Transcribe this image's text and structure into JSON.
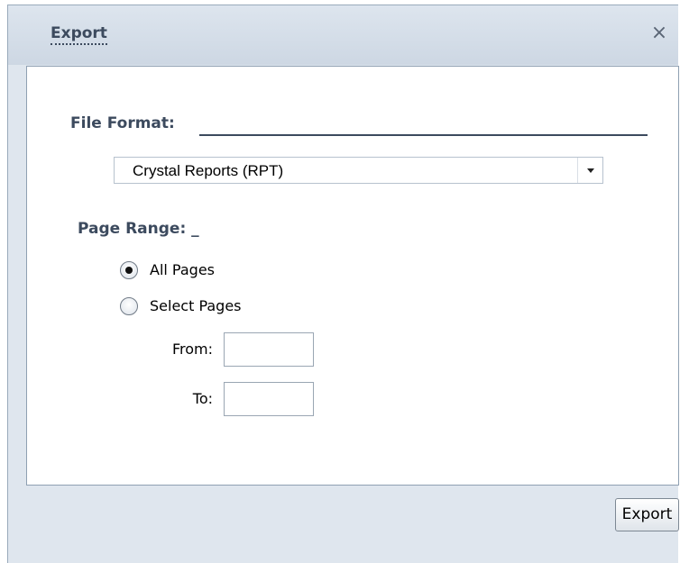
{
  "dialog": {
    "title": "Export",
    "close_glyph": "×",
    "colors": {
      "title_text": "#3c4a5e",
      "frame_bg": "#dfe6ee",
      "content_bg": "#ffffff"
    }
  },
  "form": {
    "file_format_label": "File Format:",
    "file_format_value": "Crystal Reports (RPT)",
    "page_range_label": "Page Range: _",
    "options": [
      {
        "label": "All Pages",
        "selected": true
      },
      {
        "label": "Select Pages",
        "selected": false
      }
    ],
    "from_label": "From:",
    "from_value": "",
    "to_label": "To:",
    "to_value": ""
  },
  "footer": {
    "export_label": "Export"
  },
  "icons": {
    "close": "close-icon",
    "dropdown": "chevron-down-icon"
  }
}
